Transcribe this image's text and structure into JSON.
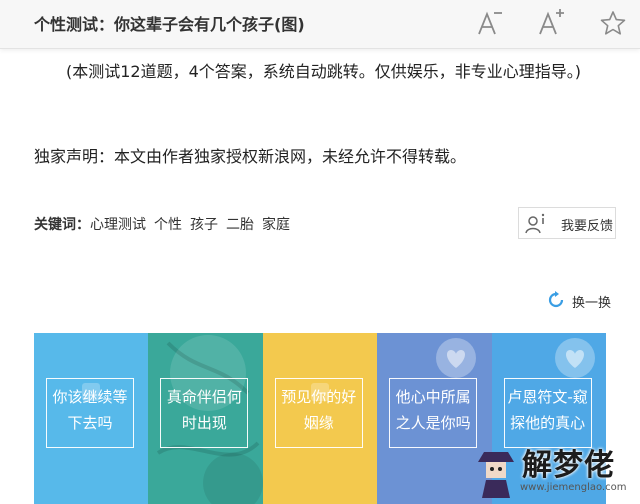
{
  "header": {
    "title": "个性测试：你这辈子会有几个孩子(图)",
    "icons": [
      "font-decrease-icon",
      "font-increase-icon",
      "star-icon"
    ]
  },
  "article": {
    "intro": "(本测试12道题，4个答案，系统自动跳转。仅供娱乐，非专业心理指导。)",
    "statement": "独家声明：本文由作者独家授权新浪网，未经允许不得转载。"
  },
  "keywords": {
    "label": "关键词：",
    "items": [
      "心理测试",
      "个性",
      "孩子",
      "二胎",
      "家庭"
    ]
  },
  "feedback": {
    "label": "我要反馈",
    "icon": "user-info-icon"
  },
  "refresh": {
    "label": "换一换",
    "icon": "refresh-icon",
    "color": "#3a9ee4"
  },
  "cards": [
    {
      "label": "你该继续等下去吗",
      "color": "#57b9ea"
    },
    {
      "label": "真命伴侣何时出现",
      "color": "#3aa89a"
    },
    {
      "label": "预见你的好姻缘",
      "color": "#f3c94e"
    },
    {
      "label": "他心中所属之人是你吗",
      "color": "#6c92d4"
    },
    {
      "label": "卢恩符文-窥探他的真心",
      "color": "#4fa8e6"
    }
  ],
  "watermark": {
    "text": "解梦佬",
    "url": "www.jiemenglao.com",
    "icon": "detective-icon"
  }
}
